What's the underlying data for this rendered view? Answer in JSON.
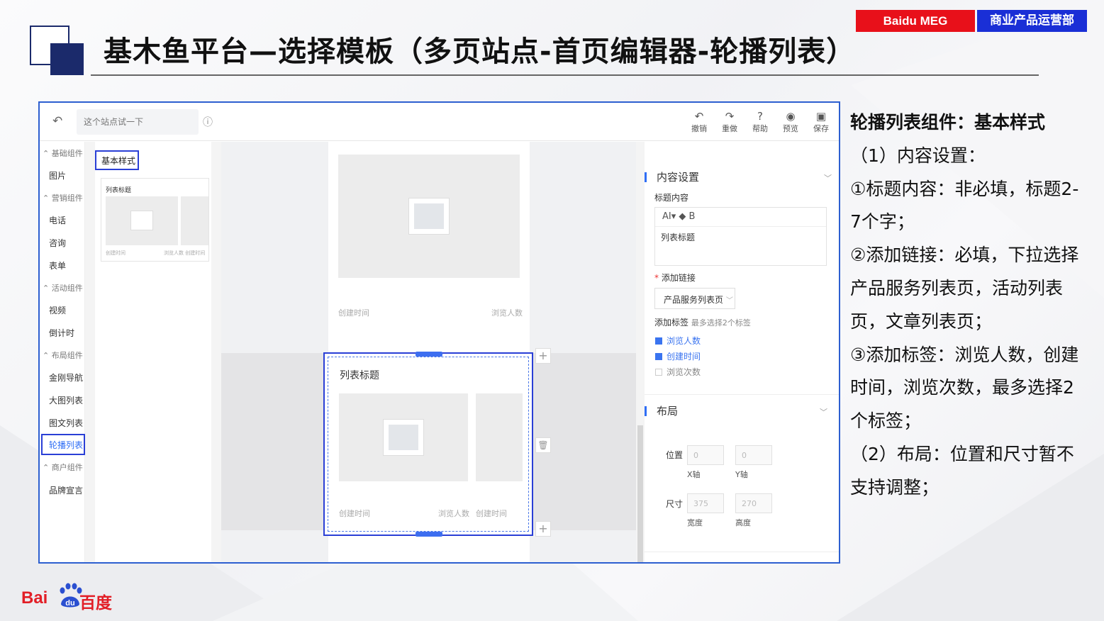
{
  "header": {
    "title": "基木鱼平台—选择模板（多页站点-首页编辑器-轮播列表）",
    "badge_brand": "Baidu MEG",
    "badge_dept": "商业产品运营部"
  },
  "topbar": {
    "site_placeholder": "这个站点试一下",
    "tools": [
      {
        "label": "撤销",
        "icon": "undo-icon"
      },
      {
        "label": "重做",
        "icon": "redo-icon"
      },
      {
        "label": "帮助",
        "icon": "help-icon"
      },
      {
        "label": "预览",
        "icon": "preview-icon"
      },
      {
        "label": "保存",
        "icon": "save-icon"
      }
    ]
  },
  "nav": {
    "groups": [
      "基础组件",
      "营销组件",
      "活动组件",
      "布局组件",
      "商户组件"
    ],
    "items": [
      "图片",
      "电话",
      "咨询",
      "表单",
      "视频",
      "倒计时",
      "金刚导航",
      "大图列表",
      "图文列表",
      "轮播列表",
      "品牌宣言"
    ],
    "active": "轮播列表"
  },
  "style_panel": {
    "tag": "基本样式",
    "thumb_title": "列表标题",
    "thumb_meta_left": "创建时间",
    "thumb_meta_right": "浏览人数  创建时间"
  },
  "canvas": {
    "upper_meta_left": "创建时间",
    "upper_meta_right": "浏览人数",
    "carousel_title": "列表标题",
    "lower_meta_left": "创建时间",
    "lower_meta_mid": "浏览人数",
    "lower_meta_right": "创建时间"
  },
  "settings": {
    "content_title": "内容设置",
    "title_label": "标题内容",
    "editor_toolbar": "AI▾    ◆    B",
    "editor_value": "列表标题",
    "link_label": "添加链接",
    "link_value": "产品服务列表页",
    "tags_label": "添加标签",
    "tags_hint": "最多选择2个标签",
    "tags": [
      {
        "label": "浏览人数",
        "checked": true
      },
      {
        "label": "创建时间",
        "checked": true
      },
      {
        "label": "浏览次数",
        "checked": false
      }
    ],
    "layout_title": "布局",
    "position_label": "位置",
    "pos_x": "0",
    "pos_y": "0",
    "x_axis": "X轴",
    "y_axis": "Y轴",
    "size_label": "尺寸",
    "width": "375",
    "height": "270",
    "width_label": "宽度",
    "height_label": "高度"
  },
  "notes": {
    "heading": "轮播列表组件：基本样式",
    "lines": [
      "（1）内容设置：",
      "①标题内容：非必填，标题2-7个字；",
      "②添加链接：必填，下拉选择产品服务列表页，活动列表页，文章列表页；",
      "③添加标签：浏览人数，创建时间，浏览次数，最多选择2个标签；",
      "（2）布局：位置和尺寸暂不支持调整；"
    ]
  },
  "footer": {
    "logo_latin": "Bai",
    "logo_du": "du",
    "logo_cn": "百度"
  },
  "colors": {
    "brand_red": "#e21e26",
    "brand_blue": "#1a2fd6",
    "navy": "#1b2a6b",
    "highlight": "#2a3fd6",
    "link_blue": "#3a74f0"
  }
}
